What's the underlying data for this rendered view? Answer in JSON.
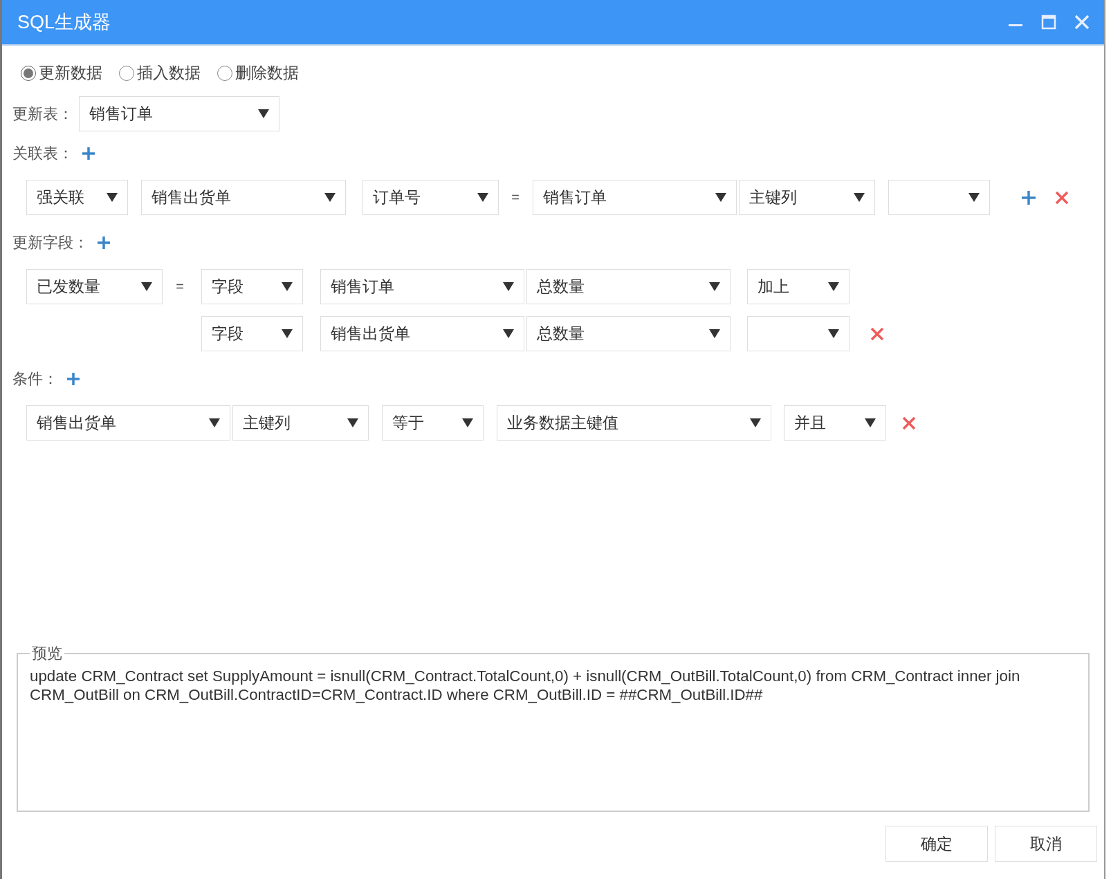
{
  "window": {
    "title": "SQL生成器"
  },
  "modes": [
    {
      "label": "更新数据",
      "selected": true
    },
    {
      "label": "插入数据",
      "selected": false
    },
    {
      "label": "删除数据",
      "selected": false
    }
  ],
  "update_table": {
    "label": "更新表：",
    "value": "销售订单"
  },
  "join_section": {
    "label": "关联表：",
    "rows": [
      {
        "cells": [
          {
            "kind": "select",
            "value": "强关联"
          },
          {
            "kind": "select",
            "value": "销售出货单"
          },
          {
            "kind": "select",
            "value": "订单号"
          },
          {
            "kind": "text",
            "text": "="
          },
          {
            "kind": "select",
            "value": "销售订单"
          },
          {
            "kind": "select",
            "value": "主键列"
          },
          {
            "kind": "select"
          },
          {
            "kind": "add"
          },
          {
            "kind": "remove"
          }
        ]
      }
    ]
  },
  "field_section": {
    "label": "更新字段：",
    "rows": [
      {
        "cells": [
          {
            "kind": "select",
            "value": "已发数量"
          },
          {
            "kind": "text",
            "text": "="
          },
          {
            "kind": "select",
            "value": "字段"
          },
          {
            "kind": "select",
            "value": "销售订单"
          },
          {
            "kind": "select",
            "value": "总数量"
          },
          {
            "kind": "select",
            "value": "加上"
          }
        ]
      },
      {
        "cells": [
          {
            "kind": "blank"
          },
          {
            "kind": "blank"
          },
          {
            "kind": "select",
            "value": "字段"
          },
          {
            "kind": "select",
            "value": "销售出货单"
          },
          {
            "kind": "select",
            "value": "总数量"
          },
          {
            "kind": "select"
          },
          {
            "kind": "remove"
          }
        ]
      }
    ]
  },
  "condition_section": {
    "label": "条件：",
    "rows": [
      {
        "cells": [
          {
            "kind": "select",
            "value": "销售出货单"
          },
          {
            "kind": "select",
            "value": "主键列"
          },
          {
            "kind": "select",
            "value": "等于"
          },
          {
            "kind": "select",
            "value": "业务数据主键值"
          },
          {
            "kind": "select",
            "value": "并且"
          },
          {
            "kind": "remove"
          }
        ]
      }
    ]
  },
  "preview": {
    "legend": "预览",
    "sql": "update CRM_Contract set SupplyAmount = isnull(CRM_Contract.TotalCount,0) + isnull(CRM_OutBill.TotalCount,0) from CRM_Contract inner join CRM_OutBill on CRM_OutBill.ContractID=CRM_Contract.ID where CRM_OutBill.ID = ##CRM_OutBill.ID##"
  },
  "buttons": [
    "确定",
    "取消"
  ]
}
